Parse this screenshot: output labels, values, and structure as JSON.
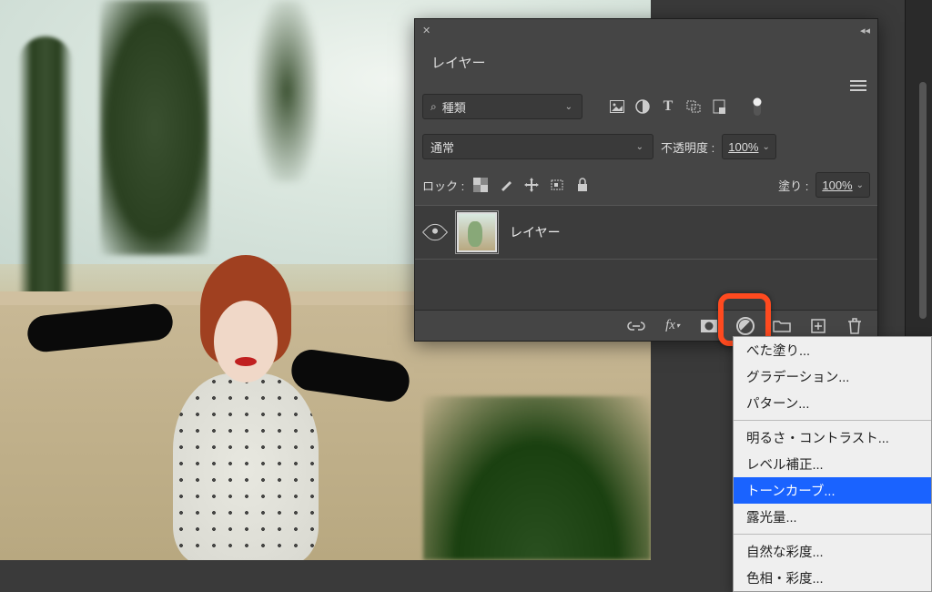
{
  "panel": {
    "title": "レイヤー",
    "filter": {
      "placeholder": "種類"
    },
    "icons": [
      "image-icon",
      "adjustment-icon",
      "type-icon",
      "shape-icon",
      "smartobject-icon",
      "toggle-icon"
    ],
    "blend_mode": "通常",
    "opacity_label": "不透明度 :",
    "opacity_value": "100%",
    "lock_label": "ロック :",
    "fill_label": "塗り :",
    "fill_value": "100%",
    "layer_name": "レイヤー"
  },
  "popup": {
    "items_top": [
      "べた塗り...",
      "グラデーション...",
      "パターン..."
    ],
    "items_mid": [
      "明るさ・コントラスト...",
      "レベル補正..."
    ],
    "highlighted": "トーンカーブ...",
    "items_after": [
      "露光量..."
    ],
    "items_bottom": [
      "自然な彩度...",
      "色相・彩度..."
    ]
  }
}
